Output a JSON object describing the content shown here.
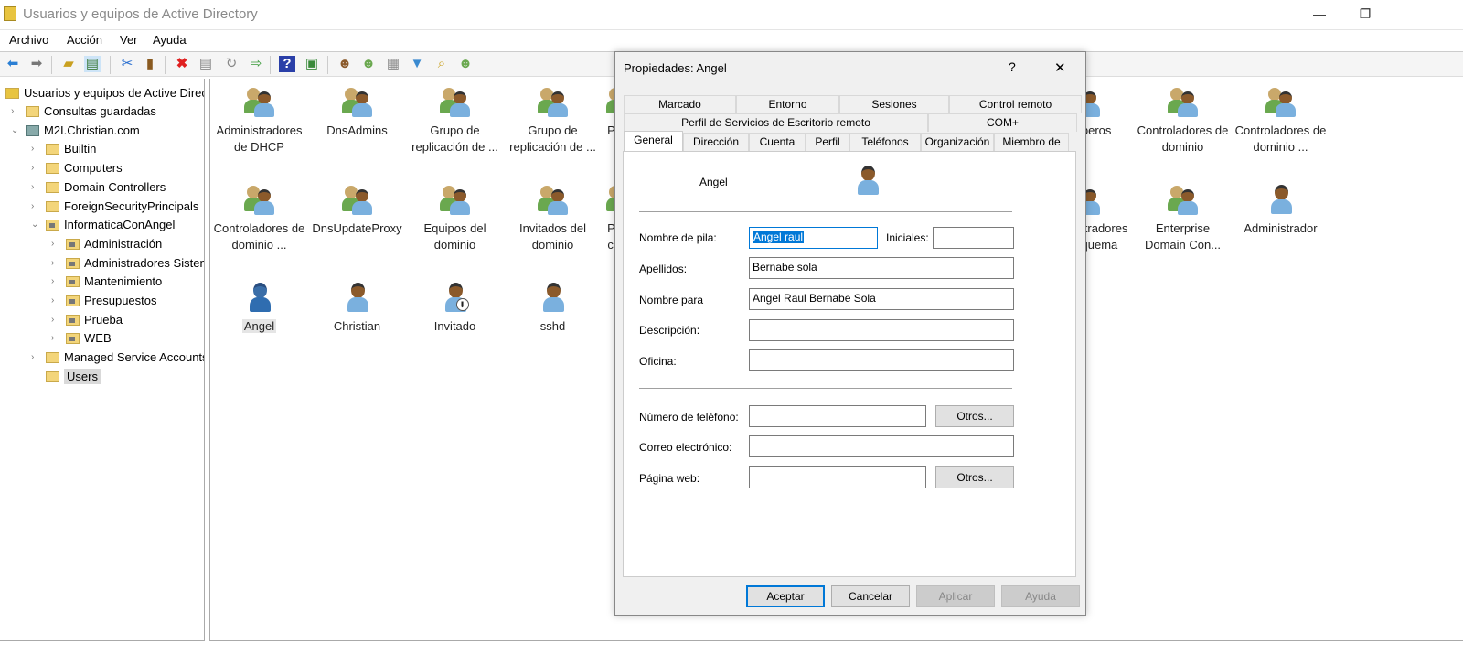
{
  "window": {
    "title": "Usuarios y equipos de Active Directory",
    "controls": {
      "minimize": "—",
      "restore": "❐"
    }
  },
  "menu": [
    "Archivo",
    "Acción",
    "Ver",
    "Ayuda"
  ],
  "toolbar": [
    "back",
    "forward",
    "up-folder",
    "show-console-tree",
    "cut",
    "paste",
    "delete",
    "properties",
    "refresh",
    "export-list",
    "help",
    "show-action-pane",
    "new-user",
    "new-group",
    "new-ou",
    "filter",
    "find",
    "add-to-group"
  ],
  "tree": {
    "root": "Usuarios y equipos de Active Directory",
    "items": [
      {
        "label": "Consultas guardadas",
        "level": 1,
        "expand": "›"
      },
      {
        "label": "M2I.Christian.com",
        "level": 1,
        "expand": "⌄"
      },
      {
        "label": "Builtin",
        "level": 2,
        "expand": "›"
      },
      {
        "label": "Computers",
        "level": 2,
        "expand": "›"
      },
      {
        "label": "Domain Controllers",
        "level": 2,
        "expand": "›"
      },
      {
        "label": "ForeignSecurityPrincipals",
        "level": 2,
        "expand": "›"
      },
      {
        "label": "InformaticaConAngel",
        "level": 2,
        "expand": "⌄"
      },
      {
        "label": "Administración",
        "level": 3,
        "expand": "›"
      },
      {
        "label": "Administradores Sistemas",
        "level": 3,
        "expand": "›"
      },
      {
        "label": "Mantenimiento",
        "level": 3,
        "expand": "›"
      },
      {
        "label": "Presupuestos",
        "level": 3,
        "expand": "›"
      },
      {
        "label": "Prueba",
        "level": 3,
        "expand": "›"
      },
      {
        "label": "WEB",
        "level": 3,
        "expand": "›"
      },
      {
        "label": "Managed Service Accounts",
        "level": 2,
        "expand": "›"
      },
      {
        "label": "Users",
        "level": 2,
        "expand": "",
        "selected": true
      }
    ]
  },
  "list": {
    "items": [
      {
        "label": "Administradores de DHCP",
        "type": "group"
      },
      {
        "label": "DnsAdmins",
        "type": "group"
      },
      {
        "label": "Grupo de replicación de ...",
        "type": "group"
      },
      {
        "label": "Grupo de replicación de ...",
        "type": "group"
      },
      {
        "label": "P...",
        "type": "group"
      },
      {
        "label": "bomberos",
        "type": "group"
      },
      {
        "label": "Controladores de dominio",
        "type": "group"
      },
      {
        "label": "Controladores de dominio ...",
        "type": "group"
      },
      {
        "label": "Controladores de dominio ...",
        "type": "group"
      },
      {
        "label": "DnsUpdateProxy",
        "type": "group"
      },
      {
        "label": "Equipos del dominio",
        "type": "group"
      },
      {
        "label": "Invitados del dominio",
        "type": "group"
      },
      {
        "label": "P... c...",
        "type": "group"
      },
      {
        "label": "Administradores de esquema",
        "type": "group"
      },
      {
        "label": "Enterprise Domain Con...",
        "type": "group"
      },
      {
        "label": "Administrador",
        "type": "user"
      },
      {
        "label": "Angel",
        "type": "user",
        "selected": true
      },
      {
        "label": "Christian",
        "type": "user"
      },
      {
        "label": "Invitado",
        "type": "user-disabled"
      },
      {
        "label": "sshd",
        "type": "user"
      }
    ]
  },
  "dialog": {
    "title": "Propiedades: Angel",
    "help": "?",
    "close": "✕",
    "tabs_row1": [
      "Marcado",
      "Entorno",
      "Sesiones",
      "Control remoto"
    ],
    "tabs_row2": [
      "Perfil de Servicios de Escritorio remoto",
      "COM+"
    ],
    "tabs_row3": [
      "General",
      "Dirección",
      "Cuenta",
      "Perfil",
      "Teléfonos",
      "Organización",
      "Miembro de"
    ],
    "active_tab": "General",
    "user_name": "Angel",
    "fields": {
      "first_name": {
        "label": "Nombre de pila:",
        "value": "Angel raul"
      },
      "initials": {
        "label": "Iniciales:",
        "value": ""
      },
      "last_name": {
        "label": "Apellidos:",
        "value": "Bernabe sola"
      },
      "display_name": {
        "label": "Nombre para",
        "value": "Angel Raul Bernabe Sola"
      },
      "description": {
        "label": "Descripción:",
        "value": ""
      },
      "office": {
        "label": "Oficina:",
        "value": ""
      },
      "phone": {
        "label": "Número de teléfono:",
        "value": ""
      },
      "email": {
        "label": "Correo electrónico:",
        "value": ""
      },
      "web": {
        "label": "Página web:",
        "value": ""
      }
    },
    "other_button": "Otros...",
    "buttons": {
      "ok": "Aceptar",
      "cancel": "Cancelar",
      "apply": "Aplicar",
      "help": "Ayuda"
    }
  }
}
